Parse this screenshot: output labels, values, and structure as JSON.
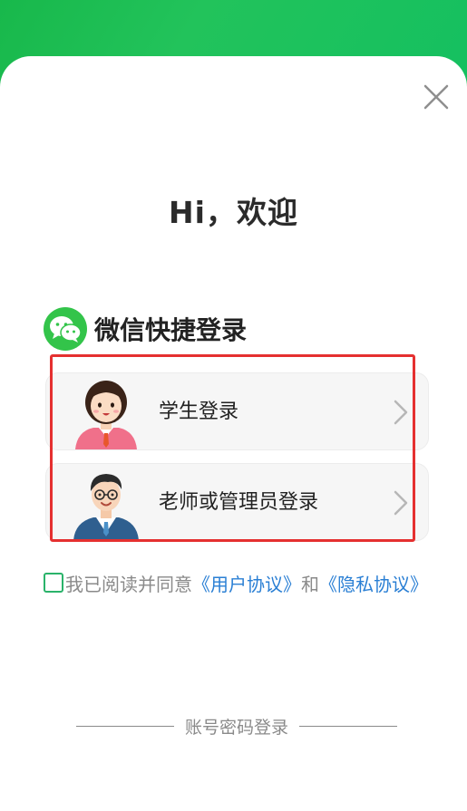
{
  "greeting": "Hi，欢迎",
  "wechat_login": {
    "title": "微信快捷登录",
    "icon": "wechat-icon"
  },
  "login_options": [
    {
      "label": "学生登录",
      "avatar": "student-avatar"
    },
    {
      "label": "老师或管理员登录",
      "avatar": "teacher-avatar"
    }
  ],
  "agreement": {
    "prefix": "我已阅读并同意",
    "user_agreement": "《用户协议》",
    "and": "和",
    "privacy_agreement": "《隐私协议》"
  },
  "account_login": "账号密码登录",
  "colors": {
    "brand_green": "#1fc45a",
    "link_blue": "#2a7fd4",
    "highlight_red": "#e53030",
    "checkbox_green": "#2ab36a"
  }
}
